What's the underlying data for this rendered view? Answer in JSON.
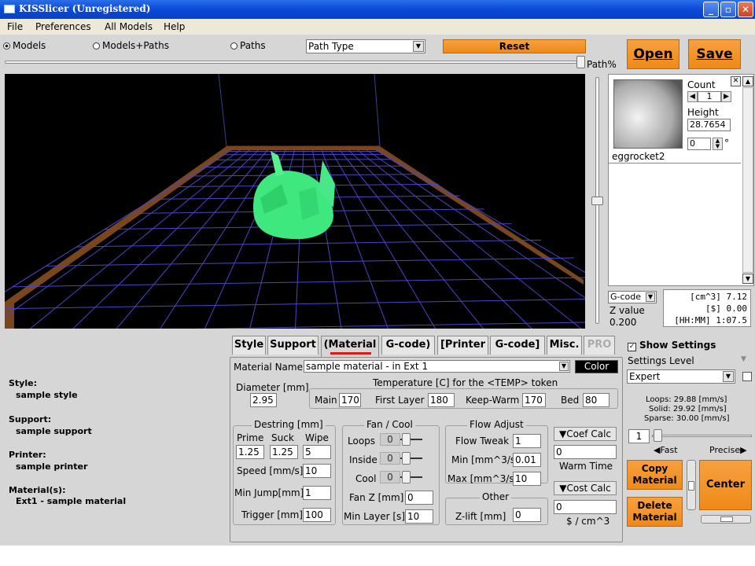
{
  "window": {
    "title": "KISSlicer (Unregistered)"
  },
  "menu": [
    "File",
    "Preferences",
    "All Models",
    "Help"
  ],
  "view_modes": {
    "models": "Models",
    "models_paths": "Models+Paths",
    "paths": "Paths",
    "selected": "Models"
  },
  "path_type": {
    "value": "Path Type"
  },
  "buttons": {
    "reset": "Reset",
    "open": "Open",
    "save": "Save",
    "copy_material": "Copy Material",
    "delete_material": "Delete Material",
    "center": "Center",
    "color": "Color"
  },
  "path_slider": {
    "label": "Path%",
    "level": 1.0
  },
  "model_panel": {
    "count_label": "Count",
    "count": "1",
    "height_label": "Height",
    "height": "28.7654",
    "rotation": "0",
    "rotation_unit": "°",
    "name": "eggrocket2"
  },
  "output": {
    "mode": "G-code",
    "z_label": "Z value",
    "z_value": "0.200",
    "volume": "[cm^3]  7.12",
    "cost": "[$]  0.00",
    "time": "[HH:MM]  1:07.5"
  },
  "tabs": [
    "Style",
    "Support",
    "(Material",
    "G-code)",
    "[Printer",
    "G-code]",
    "Misc.",
    "PRO"
  ],
  "active_tab": "(Material",
  "summary": [
    {
      "head": "Style:",
      "value": "sample style"
    },
    {
      "head": "Support:",
      "value": "sample support"
    },
    {
      "head": "Printer:",
      "value": "sample printer"
    },
    {
      "head": "Material(s):",
      "value": "Ext1 - sample material"
    }
  ],
  "material": {
    "name_label": "Material Name",
    "name_value": "sample material - in Ext 1",
    "diameter_label": "Diameter [mm]",
    "diameter": "2.95",
    "temp_title": "Temperature [C] for the <TEMP> token",
    "main_label": "Main",
    "main": "170",
    "first_layer_label": "First Layer",
    "first_layer": "180",
    "keep_warm_label": "Keep-Warm",
    "keep_warm": "170",
    "bed_label": "Bed",
    "bed": "80"
  },
  "destring": {
    "title": "Destring [mm]",
    "prime_label": "Prime",
    "suck_label": "Suck",
    "wipe_label": "Wipe",
    "prime": "1.25",
    "suck": "1.25",
    "wipe": "5",
    "speed_label": "Speed [mm/s]",
    "speed": "10",
    "min_jump_label": "Min Jump[mm]",
    "min_jump": "1",
    "trigger_label": "Trigger [mm]",
    "trigger": "100"
  },
  "fan": {
    "title": "Fan / Cool",
    "loops_label": "Loops",
    "loops": "0",
    "inside_label": "Inside",
    "inside": "0",
    "cool_label": "Cool",
    "cool": "0",
    "fan_z_label": "Fan Z [mm]",
    "fan_z": "0",
    "min_layer_label": "Min Layer [s]",
    "min_layer": "10"
  },
  "flow": {
    "title": "Flow Adjust",
    "tweak_label": "Flow Tweak",
    "tweak": "1",
    "min_label": "Min [mm^3/s]",
    "min": "0.01",
    "max_label": "Max [mm^3/s]",
    "max": "10",
    "other_title": "Other",
    "zlift_label": "Z-lift [mm]",
    "zlift": "0"
  },
  "calc": {
    "coef_label": "Coef Calc",
    "coef_value": "0",
    "warm_time_label": "Warm Time",
    "cost_label": "Cost Calc",
    "cost_value": "0",
    "cost_unit": "$ / cm^3"
  },
  "settings": {
    "show_label": "Show Settings",
    "show_checked": true,
    "level_label": "Settings Level",
    "level_value": "Expert",
    "loops_speed": "Loops:  29.88 [mm/s]",
    "solid_speed": "Solid:  29.92 [mm/s]",
    "sparse_speed": "Sparse: 30.00 [mm/s]",
    "speed_value": "1",
    "fast_label": "Fast",
    "precise_label": "Precise"
  },
  "colors": {
    "accent": "#f08c1c",
    "viewport_bg": "#000000",
    "grid": "#4a45c8",
    "model": "#3fe87f",
    "bed_border": "#7a4a20"
  }
}
